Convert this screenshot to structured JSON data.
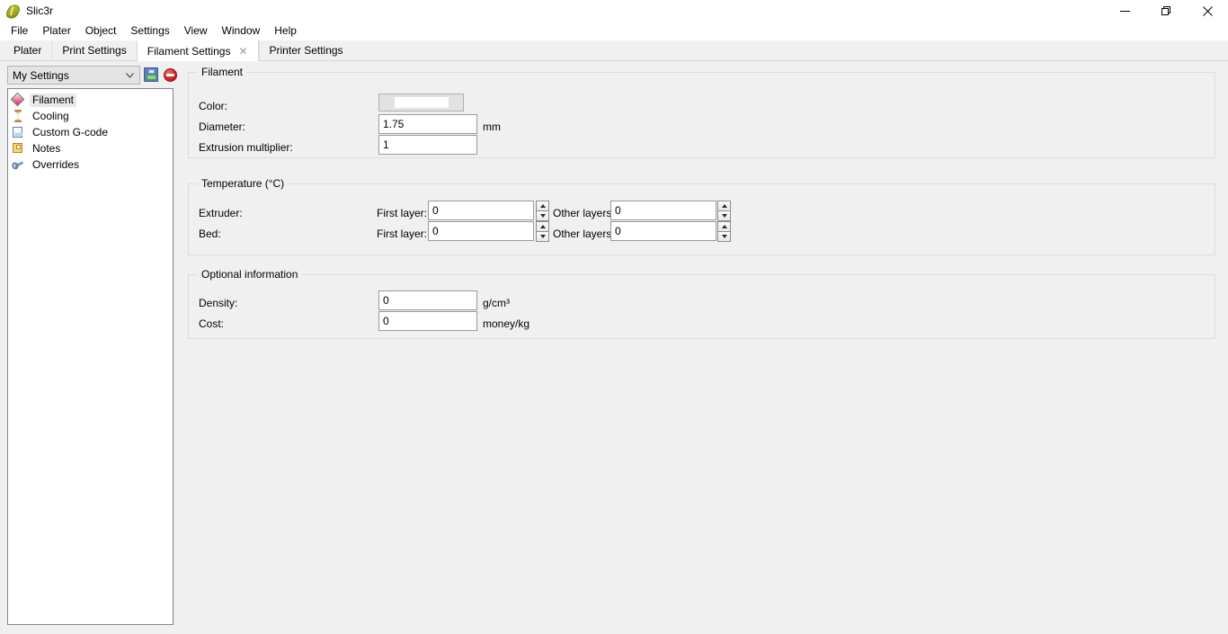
{
  "window": {
    "title": "Slic3r",
    "app_icon": "slic3r-leaf-icon",
    "controls": [
      {
        "name": "minimize",
        "glyph": "minimize-icon"
      },
      {
        "name": "restore",
        "glyph": "restore-icon"
      },
      {
        "name": "close",
        "glyph": "close-icon"
      }
    ]
  },
  "menubar": {
    "items": [
      {
        "label": "File"
      },
      {
        "label": "Plater"
      },
      {
        "label": "Object"
      },
      {
        "label": "Settings"
      },
      {
        "label": "View"
      },
      {
        "label": "Window"
      },
      {
        "label": "Help"
      }
    ]
  },
  "tabs": {
    "items": [
      {
        "label": "Plater",
        "active": false,
        "closable": false
      },
      {
        "label": "Print Settings",
        "active": false,
        "closable": false
      },
      {
        "label": "Filament Settings",
        "active": true,
        "closable": true,
        "close_label": "✕"
      },
      {
        "label": "Printer Settings",
        "active": false,
        "closable": false
      }
    ]
  },
  "sidebar": {
    "preset": {
      "value": "My Settings",
      "arrow_icon": "chevron-down-icon",
      "save_icon": "floppy-save-icon",
      "delete_icon": "delete-preset-icon"
    },
    "items": [
      {
        "label": "Filament",
        "icon": "filament-icon",
        "selected": true
      },
      {
        "label": "Cooling",
        "icon": "hourglass-icon",
        "selected": false
      },
      {
        "label": "Custom G-code",
        "icon": "page-icon",
        "selected": false
      },
      {
        "label": "Notes",
        "icon": "note-icon",
        "selected": false
      },
      {
        "label": "Overrides",
        "icon": "wrench-icon",
        "selected": false
      }
    ]
  },
  "groups": {
    "filament": {
      "title": "Filament",
      "color": {
        "label": "Color:",
        "swatch_hex": "#ffffff"
      },
      "diameter": {
        "label": "Diameter:",
        "value": "1.75",
        "unit": "mm"
      },
      "extrusion_multiplier": {
        "label": "Extrusion multiplier:",
        "value": "1",
        "unit": ""
      }
    },
    "temperature": {
      "title": "Temperature (°C)",
      "rows": [
        {
          "label": "Extruder:",
          "first_layer_label": "First layer:",
          "first_layer_value": "0",
          "other_layers_label": "Other layers:",
          "other_layers_value": "0"
        },
        {
          "label": "Bed:",
          "first_layer_label": "First layer:",
          "first_layer_value": "0",
          "other_layers_label": "Other layers:",
          "other_layers_value": "0"
        }
      ]
    },
    "optional": {
      "title": "Optional information",
      "density": {
        "label": "Density:",
        "value": "0",
        "unit": "g/cm³"
      },
      "cost": {
        "label": "Cost:",
        "value": "0",
        "unit": "money/kg"
      }
    }
  }
}
